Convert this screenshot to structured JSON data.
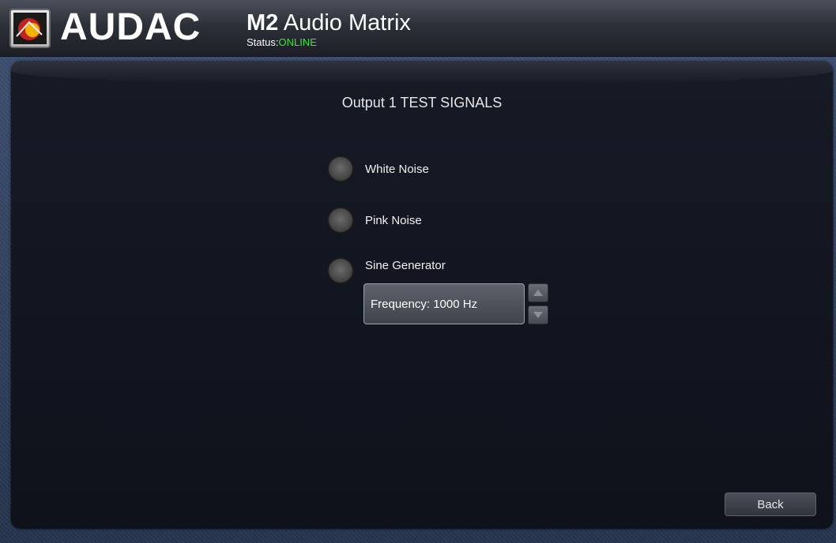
{
  "header": {
    "brand": "AUDAC",
    "model": "M2",
    "product_name": "Audio Matrix",
    "status_label": "Status:",
    "status_value": "ONLINE"
  },
  "page": {
    "title": "Output 1 TEST SIGNALS"
  },
  "options": [
    {
      "label": "White Noise",
      "selected": false
    },
    {
      "label": "Pink Noise",
      "selected": false
    },
    {
      "label": "Sine Generator",
      "selected": false
    }
  ],
  "frequency": {
    "label": "Frequency: 1000 Hz"
  },
  "footer": {
    "back_label": "Back"
  },
  "colors": {
    "status_online": "#35e83a",
    "panel_background": "#131722",
    "frame_background": "#2b3a55"
  }
}
